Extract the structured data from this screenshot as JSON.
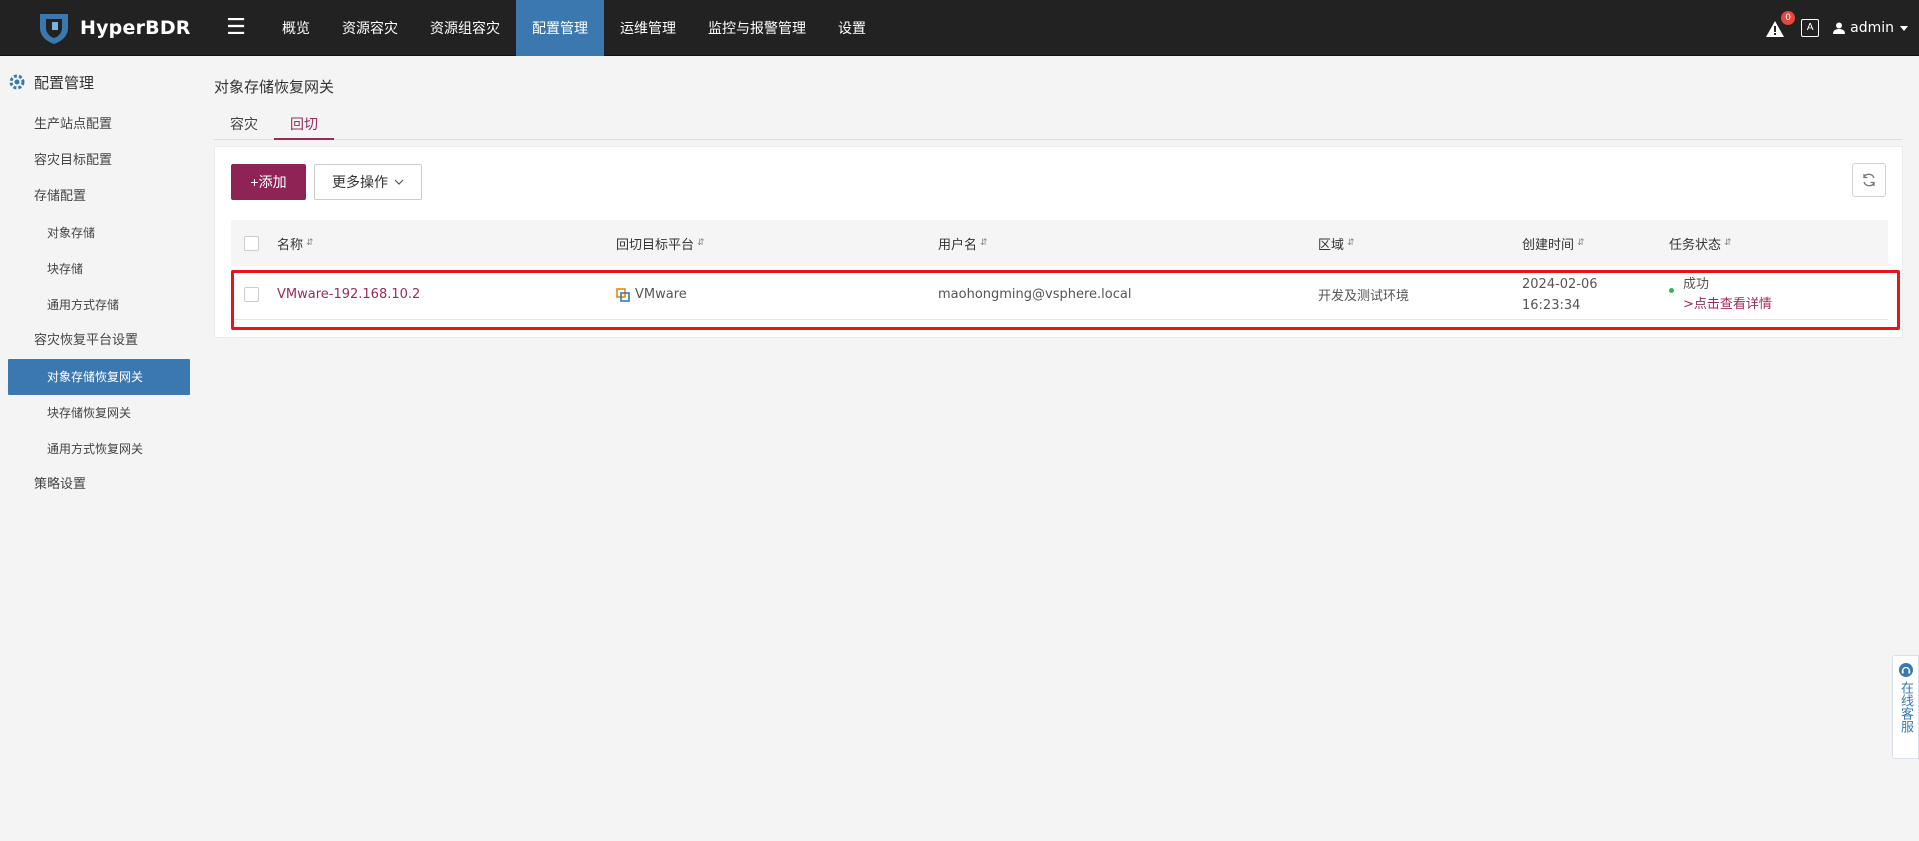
{
  "app": {
    "name": "HyperBDR"
  },
  "topnav": {
    "items": [
      {
        "label": "概览",
        "active": false
      },
      {
        "label": "资源容灾",
        "active": false
      },
      {
        "label": "资源组容灾",
        "active": false
      },
      {
        "label": "配置管理",
        "active": true
      },
      {
        "label": "运维管理",
        "active": false
      },
      {
        "label": "监控与报警管理",
        "active": false
      },
      {
        "label": "设置",
        "active": false
      }
    ],
    "alert_count": "0",
    "lang_label": "A",
    "user": "admin"
  },
  "sidebar": {
    "title": "配置管理",
    "items": [
      {
        "label": "生产站点配置"
      },
      {
        "label": "容灾目标配置"
      },
      {
        "label": "存储配置"
      },
      {
        "label": "对象存储"
      },
      {
        "label": "块存储"
      },
      {
        "label": "通用方式存储"
      },
      {
        "label": "容灾恢复平台设置"
      },
      {
        "label": "对象存储恢复网关"
      },
      {
        "label": "块存储恢复网关"
      },
      {
        "label": "通用方式恢复网关"
      },
      {
        "label": "策略设置"
      }
    ]
  },
  "main": {
    "title": "对象存储恢复网关",
    "tabs": [
      {
        "label": "容灾"
      },
      {
        "label": "回切"
      }
    ],
    "buttons": {
      "add": "+添加",
      "more": "更多操作"
    },
    "table": {
      "headers": {
        "name": "名称",
        "platform": "回切目标平台",
        "username": "用户名",
        "region": "区域",
        "created": "创建时间",
        "status": "任务状态"
      },
      "rows": [
        {
          "name": "VMware-192.168.10.2",
          "platform": "VMware",
          "username": "maohongming@vsphere.local",
          "region": "开发及测试环境",
          "created_date": "2024-02-06",
          "created_time": "16:23:34",
          "status": "成功",
          "detail_link": ">点击查看详情"
        }
      ]
    }
  },
  "support": {
    "label": "在线客服"
  },
  "colors": {
    "primary": "#8e2455",
    "nav_active": "#3c78b0",
    "success": "#3bb34a",
    "highlight": "#e8141b"
  }
}
